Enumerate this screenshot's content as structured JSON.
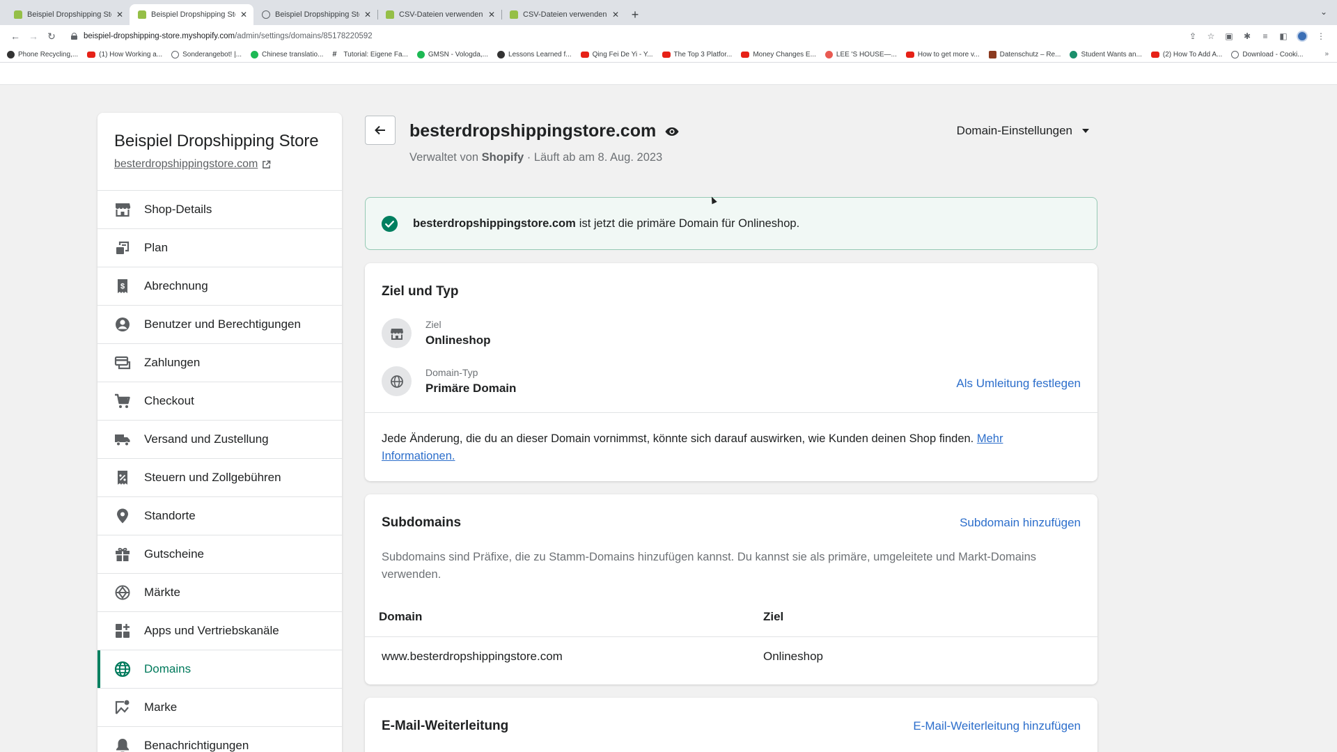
{
  "browser": {
    "tabs": [
      {
        "title": "Beispiel Dropshipping Store · D",
        "icon": "shopify-icon",
        "active": false
      },
      {
        "title": "Beispiel Dropshipping Store · D",
        "icon": "shopify-icon",
        "active": true
      },
      {
        "title": "Beispiel Dropshipping Store",
        "icon": "globe-icon",
        "active": false
      },
      {
        "title": "CSV-Dateien verwenden, um P",
        "icon": "shopify-icon",
        "active": false
      },
      {
        "title": "CSV-Dateien verwenden, um P",
        "icon": "shopify-icon",
        "active": false
      }
    ],
    "new_tab": "+",
    "url_host": "beispiel-dropshipping-store.myshopify.com",
    "url_path": "/admin/settings/domains/85178220592",
    "bookmarks": [
      {
        "label": "Phone Recycling,...",
        "icon": "dark"
      },
      {
        "label": "(1) How Working a...",
        "icon": "yt"
      },
      {
        "label": "Sonderangebot! |...",
        "icon": "gray"
      },
      {
        "label": "Chinese translatio...",
        "icon": "green"
      },
      {
        "label": "Tutorial: Eigene Fa...",
        "icon": "hash"
      },
      {
        "label": "GMSN - Vologda,...",
        "icon": "green"
      },
      {
        "label": "Lessons Learned f...",
        "icon": "dark"
      },
      {
        "label": "Qing Fei De Yi - Y...",
        "icon": "yt"
      },
      {
        "label": "The Top 3 Platfor...",
        "icon": "yt"
      },
      {
        "label": "Money Changes E...",
        "icon": "yt"
      },
      {
        "label": "LEE 'S HOUSE—...",
        "icon": "red"
      },
      {
        "label": "How to get more v...",
        "icon": "yt"
      },
      {
        "label": "Datenschutz – Re...",
        "icon": "brown"
      },
      {
        "label": "Student Wants an...",
        "icon": "teal"
      },
      {
        "label": "(2) How To Add A...",
        "icon": "yt"
      },
      {
        "label": "Download - Cooki...",
        "icon": "gray"
      }
    ],
    "bookmarks_more": "»"
  },
  "sidebar": {
    "store_name": "Beispiel Dropshipping Store",
    "store_url": "besterdropshippingstore.com",
    "items": [
      {
        "label": "Shop-Details",
        "icon": "store-icon",
        "active": false
      },
      {
        "label": "Plan",
        "icon": "plan-icon",
        "active": false
      },
      {
        "label": "Abrechnung",
        "icon": "billing-icon",
        "active": false
      },
      {
        "label": "Benutzer und Berechtigungen",
        "icon": "user-icon",
        "active": false
      },
      {
        "label": "Zahlungen",
        "icon": "payments-icon",
        "active": false
      },
      {
        "label": "Checkout",
        "icon": "cart-icon",
        "active": false
      },
      {
        "label": "Versand und Zustellung",
        "icon": "truck-icon",
        "active": false
      },
      {
        "label": "Steuern und Zollgebühren",
        "icon": "tax-icon",
        "active": false
      },
      {
        "label": "Standorte",
        "icon": "location-icon",
        "active": false
      },
      {
        "label": "Gutscheine",
        "icon": "gift-icon",
        "active": false
      },
      {
        "label": "Märkte",
        "icon": "markets-icon",
        "active": false
      },
      {
        "label": "Apps und Vertriebskanäle",
        "icon": "apps-icon",
        "active": false
      },
      {
        "label": "Domains",
        "icon": "globe-icon",
        "active": true
      },
      {
        "label": "Marke",
        "icon": "brand-icon",
        "active": false
      },
      {
        "label": "Benachrichtigungen",
        "icon": "bell-icon",
        "active": false
      }
    ]
  },
  "header": {
    "title": "besterdropshippingstore.com",
    "managed_prefix": "Verwaltet von",
    "managed_by": "Shopify",
    "expires": "· Läuft ab am 8. Aug. 2023",
    "settings_dropdown": "Domain-Einstellungen"
  },
  "banner": {
    "domain": "besterdropshippingstore.com",
    "message": "ist jetzt die primäre Domain für Onlineshop."
  },
  "target_card": {
    "title": "Ziel und Typ",
    "target_label": "Ziel",
    "target_value": "Onlineshop",
    "type_label": "Domain-Typ",
    "type_value": "Primäre Domain",
    "redirect_link": "Als Umleitung festlegen",
    "notice": "Jede Änderung, die du an dieser Domain vornimmst, könnte sich darauf auswirken, wie Kunden deinen Shop finden.",
    "more_info": "Mehr Informationen."
  },
  "subdomains_card": {
    "title": "Subdomains",
    "add_link": "Subdomain hinzufügen",
    "description": "Subdomains sind Präfixe, die zu Stamm-Domains hinzufügen kannst. Du kannst sie als primäre, umgeleitete und Markt-Domains verwenden.",
    "columns": [
      "Domain",
      "Ziel"
    ],
    "rows": [
      {
        "domain": "www.besterdropshippingstore.com",
        "target": "Onlineshop"
      }
    ]
  },
  "email_card": {
    "title": "E-Mail-Weiterleitung",
    "add_link": "E-Mail-Weiterleitung hinzufügen"
  },
  "colors": {
    "accent_green": "#008060",
    "link_blue": "#2c6ecb",
    "banner_bg": "#f1f8f5"
  }
}
